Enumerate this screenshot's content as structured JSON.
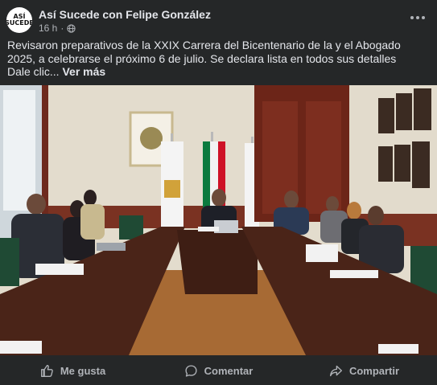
{
  "post": {
    "author": "Así Sucede con Felipe González",
    "time": "16 h",
    "avatar_text": "ASÍ SUCEDE",
    "text": "Revisaron preparativos de la XXIX Carrera del Bicentenario de la y el Abogado 2025, a celebrarse el próximo 6 de julio. Se declara lista en todos sus detalles",
    "cta": "Dale clic...",
    "see_more": "Ver más"
  },
  "photo": {
    "description_icon": "photo-image",
    "flag_colors": [
      "#0b7a3e",
      "#ffffff",
      "#ce1126"
    ],
    "wall_color": "#e7e1d3",
    "table_color": "#4a2418"
  },
  "actions": [
    {
      "label": "Me gusta",
      "icon": "thumbs-up-icon"
    },
    {
      "label": "Comentar",
      "icon": "comment-icon"
    },
    {
      "label": "Compartir",
      "icon": "share-icon"
    }
  ],
  "colors": {
    "background": "#252728",
    "text_primary": "#e4e6eb",
    "text_secondary": "#b0b3b8"
  }
}
